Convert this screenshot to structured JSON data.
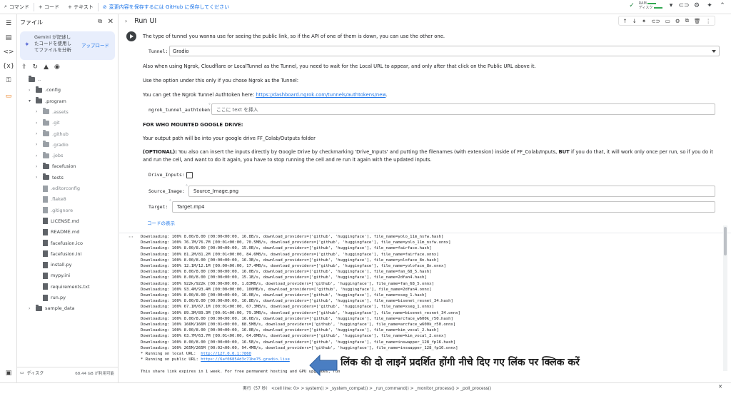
{
  "toolbar": {
    "search_label": "コマンド",
    "add_code": "+ コード",
    "add_text": "+ テキスト",
    "save_notice": "変更内容を保存するには GitHub に保存してください",
    "ram_label": "RAM",
    "disk_label": "ディスク"
  },
  "files_panel": {
    "title": "ファイル",
    "gemini_text": "Gemini が記述したコードを使用してファイルを分析",
    "upload_label": "アップロード",
    "tree": [
      {
        "name": "..",
        "kind": "folder",
        "level": 0
      },
      {
        "name": ".config",
        "kind": "folder",
        "level": 1
      },
      {
        "name": ".program",
        "kind": "folder",
        "level": 1,
        "open": true
      },
      {
        "name": ".assets",
        "kind": "folder",
        "level": 2,
        "dim": true
      },
      {
        "name": ".git",
        "kind": "folder",
        "level": 2,
        "dim": true
      },
      {
        "name": ".github",
        "kind": "folder",
        "level": 2,
        "dim": true
      },
      {
        "name": ".gradio",
        "kind": "folder",
        "level": 2,
        "dim": true
      },
      {
        "name": ".jobs",
        "kind": "folder",
        "level": 2,
        "dim": true
      },
      {
        "name": "facefusion",
        "kind": "folder",
        "level": 2
      },
      {
        "name": "tests",
        "kind": "folder",
        "level": 2
      },
      {
        "name": ".editorconfig",
        "kind": "file",
        "level": 2,
        "dim": true
      },
      {
        "name": ".flake8",
        "kind": "file",
        "level": 2,
        "dim": true
      },
      {
        "name": ".gitignore",
        "kind": "file",
        "level": 2,
        "dim": true
      },
      {
        "name": "LICENSE.md",
        "kind": "file",
        "level": 2
      },
      {
        "name": "README.md",
        "kind": "file",
        "level": 2
      },
      {
        "name": "facefusion.ico",
        "kind": "file",
        "level": 2
      },
      {
        "name": "facefusion.ini",
        "kind": "file",
        "level": 2
      },
      {
        "name": "install.py",
        "kind": "file",
        "level": 2
      },
      {
        "name": "mypy.ini",
        "kind": "file",
        "level": 2
      },
      {
        "name": "requirements.txt",
        "kind": "file",
        "level": 2
      },
      {
        "name": "run.py",
        "kind": "file",
        "level": 2
      },
      {
        "name": "sample_data",
        "kind": "folder",
        "level": 1
      }
    ],
    "disk_label": "ディスク",
    "disk_value": "68.44 GB が利用可能"
  },
  "cell": {
    "title": "Run UI",
    "tunnel_intro": "The type of tunnel you wanna use for seeing the public link, so if the API of one of them is down, you can use the other one.",
    "tunnel_label": "Tunnel:",
    "tunnel_value": "Gradio",
    "ngrok_note": "Also when using Ngrok, Cloudflare or LocalTunnel as the Tunnel, you need to wait for the Local URL to appear, and only after that click on the Public URL above it.",
    "ngrok_option": "Use the option under this only if you chose Ngrok as the Tunnel:",
    "authtoken_prefix": "You can get the Ngrok Tunnel Authtoken here: ",
    "authtoken_link": "https://dashboard.ngrok.com/tunnels/authtokens/new",
    "authtoken_suffix": ".",
    "authtoken_label": "ngrok_tunnel_authtoken:",
    "authtoken_placeholder": "ここに text を挿入",
    "drive_heading": "FOR WHO MOUNTED GOOGLE DRIVE:",
    "drive_output": "Your output path will be into your google drive FF_Colab/Outputs folder",
    "optional_bold": "(OPTIONAL):",
    "optional_text1": " You also can insert the inputs directly by Google Drive by checkmarking 'Drive_Inputs' and putting the filenames (with extension) inside of FF_Colab/Inputs, ",
    "optional_but": "BUT",
    "optional_text2": " if you do that, it will work only once per run, so if you do it and run the cell, and want to do it again, you have to stop running the cell and re run it again with the updated inputs.",
    "drive_inputs_label": "Drive_Inputs:",
    "source_label": "Source_Image:",
    "source_value": "Source_Image.png",
    "target_label": "Target:",
    "target_value": "Target.mp4",
    "show_code": "コードの表示"
  },
  "output": {
    "lines": [
      "Downloading: 100% 8.00/8.00 [00:00<00:00, 16.8B/s, download_providers=['github', 'huggingface'], file_name=yolo_11m_nsfw.hash]",
      "Downloading: 100% 76.7M/76.7M [00:01<00:00, 70.5MB/s, download_providers=['github', 'huggingface'], file_name=yolo_11m_nsfw.onnx]",
      "Downloading: 100% 8.00/8.00 [00:00<00:00, 15.0B/s, download_providers=['github', 'huggingface'], file_name=fairface.hash]",
      "Downloading: 100% 81.2M/81.2M [00:01<00:00, 84.6MB/s, download_providers=['github', 'huggingface'], file_name=fairface.onnx]",
      "Downloading: 100% 8.00/8.00 [00:00<00:00, 16.3B/s, download_providers=['github', 'huggingface'], file_name=yoloface_8n.hash]",
      "Downloading: 100% 12.1M/12.1M [00:00<00:00, 17.4MB/s, download_providers=['github', 'huggingface'], file_name=yoloface_8n.onnx]",
      "Downloading: 100% 8.00/8.00 [00:00<00:00, 16.0B/s, download_providers=['github', 'huggingface'], file_name=fan_68_5.hash]",
      "Downloading: 100% 8.00/8.00 [00:00<00:00, 15.1B/s, download_providers=['github', 'huggingface'], file_name=2dfan4.hash]",
      "Downloading: 100% 922k/922k [00:00<00:00, 1.83MB/s, download_providers=['github', 'huggingface'], file_name=fan_68_5.onnx]",
      "Downloading: 100% 93.4M/93.4M [00:00<00:00, 100MB/s, download_providers=['github', 'huggingface'], file_name=2dfan4.onnx]",
      "Downloading: 100% 8.00/8.00 [00:00<00:00, 16.0B/s, download_providers=['github', 'huggingface'], file_name=xseg_1.hash]",
      "Downloading: 100% 8.00/8.00 [00:00<00:00, 16.8B/s, download_providers=['github', 'huggingface'], file_name=bisenet_resnet_34.hash]",
      "Downloading: 100% 67.1M/67.1M [00:01<00:00, 67.3MB/s, download_providers=['github', 'huggingface'], file_name=xseg_1.onnx]",
      "Downloading: 100% 89.3M/89.3M [00:01<00:00, 79.3MB/s, download_providers=['github', 'huggingface'], file_name=bisenet_resnet_34.onnx]",
      "Downloading: 100% 8.00/8.00 [00:00<00:00, 16.6B/s, download_providers=['github', 'huggingface'], file_name=arcface_w600k_r50.hash]",
      "Downloading: 100% 166M/166M [00:01<00:00, 88.5MB/s, download_providers=['github', 'huggingface'], file_name=arcface_w600k_r50.onnx]",
      "Downloading: 100% 8.00/8.00 [00:00<00:00, 16.0B/s, download_providers=['github', 'huggingface'], file_name=kim_vocal_2.hash]",
      "Downloading: 100% 63.7M/63.7M [00:01<00:00, 64.0MB/s, download_providers=['github', 'huggingface'], file_name=kim_vocal_2.onnx]",
      "Downloading: 100% 8.00/8.00 [00:00<00:00, 16.5B/s, download_providers=['github', 'huggingface'], file_name=inswapper_128_fp16.hash]",
      "Downloading: 100% 265M/265M [00:02<00:00, 94.4MB/s, download_providers=['github', 'huggingface'], file_name=inswapper_128_fp16.onnx]"
    ],
    "local_prefix": "* Running on local URL:  ",
    "local_url": "http://127.0.0.1:7860",
    "public_prefix": "* Running on public URL: ",
    "public_url": "https://6af06854d3c71be75.gradio.live",
    "expiry_text": "This share link expires in 1 week. For free permanent hosting and GPU upgrades, run"
  },
  "annotation": {
    "text": "लिंक की दो लाइनें प्रदर्शित होंगी नीचे दिए गए लिंक पर क्लिक करें",
    "arrow_color": "#4a7ec2"
  },
  "status_bar": {
    "text": "実行（57 秒）  <cell line: 0> > system() > _system_compat() > _run_command() > _monitor_process() > _poll_process()"
  },
  "colors": {
    "accent": "#1a73e8",
    "active_rail": "#e8710a"
  }
}
